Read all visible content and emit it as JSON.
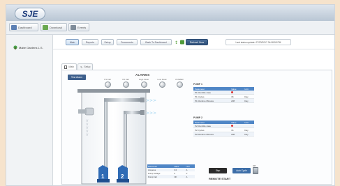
{
  "app": {
    "logo": "SJE"
  },
  "menu": {
    "items": [
      {
        "label": "Dashboard",
        "icon": "dashboard-icon"
      },
      {
        "label": "Download",
        "icon": "download-icon"
      },
      {
        "label": "Events",
        "icon": "events-icon"
      }
    ]
  },
  "sidebar": {
    "site": "Mabe Gardens L.S."
  },
  "toolbar": {
    "buttons": [
      "Main",
      "Reports",
      "Setup",
      "Documents",
      "Back To Dashboard"
    ],
    "refresh_label": "Refresh Now",
    "last_update": "Last status update: 07/23/2017 04:08:55 PM"
  },
  "tabs": [
    "Main",
    "Setup"
  ],
  "panel": {
    "test_button": "Test Alarm",
    "alarms": {
      "title": "ALARMS",
      "items": [
        "P1 Fail",
        "P2 Fail",
        "High Float",
        "Low Float",
        "POWER"
      ]
    },
    "pump1": {
      "title": "PUMP 1",
      "headers": [
        "Parameter",
        "Value",
        "Unit"
      ],
      "rows": [
        [
          "P1 Run/Idle state",
          "",
          ""
        ],
        [
          "P1 Cycles",
          "18",
          "Day"
        ],
        [
          "P1 Runtime Minutes",
          "238",
          "Day"
        ]
      ]
    },
    "pump2": {
      "title": "PUMP 2",
      "headers": [
        "Parameter",
        "Value",
        "Unit"
      ],
      "rows": [
        [
          "P2 Run/Idle state",
          "",
          ""
        ],
        [
          "P2 Cycles",
          "16",
          "Day"
        ],
        [
          "P2 Runtime Minutes",
          "238",
          "Day"
        ]
      ]
    },
    "bottom_table": {
      "headers": [
        "Parameter",
        "Value",
        "Unit"
      ],
      "rows": [
        [
          "Amperes",
          "0.0",
          "A"
        ],
        [
          "Pump Voltage",
          "0",
          "V"
        ],
        [
          "Pump Fail",
          "OK",
          "A"
        ]
      ]
    },
    "pump_numbers": [
      "1",
      "2"
    ],
    "controls": {
      "stop": "Stop",
      "auto_cycle": "Auto Cycle",
      "off": "Off"
    },
    "remote_start": "REMOTE START"
  }
}
